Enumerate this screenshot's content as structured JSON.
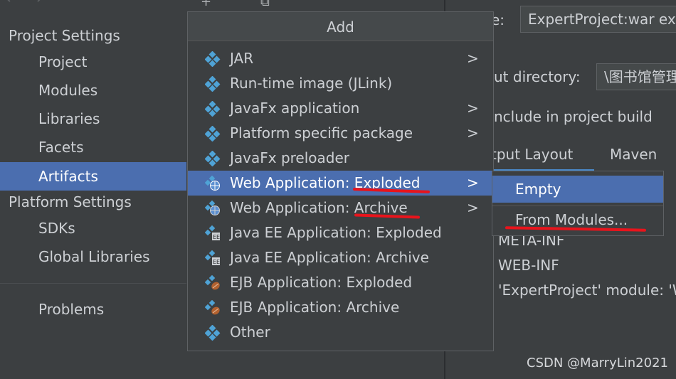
{
  "sidebar": {
    "project_settings_title": "Project Settings",
    "project_items": [
      {
        "label": "Project"
      },
      {
        "label": "Modules"
      },
      {
        "label": "Libraries"
      },
      {
        "label": "Facets"
      },
      {
        "label": "Artifacts"
      }
    ],
    "platform_settings_title": "Platform Settings",
    "platform_items": [
      {
        "label": "SDKs"
      },
      {
        "label": "Global Libraries"
      }
    ],
    "problems_label": "Problems"
  },
  "details": {
    "name_label_partial": "e:",
    "name_value": "ExpertProject:war ex",
    "output_dir_label_partial": "ut directory:",
    "output_dir_value": "\\图书馆管理",
    "include_label_partial": "nclude in project build",
    "tabs": [
      {
        "label": "tput Layout"
      },
      {
        "label": "Maven"
      }
    ],
    "tree": [
      {
        "label": "META-INF"
      },
      {
        "label": "WEB-INF"
      },
      {
        "label": "'ExpertProject' module: 'W"
      }
    ]
  },
  "popup": {
    "title": "Add",
    "items": [
      {
        "label": "JAR",
        "icon": "artifact-icon",
        "submenu": ">"
      },
      {
        "label": "Run-time image (JLink)",
        "icon": "artifact-icon",
        "submenu": ""
      },
      {
        "label": "JavaFx application",
        "icon": "artifact-icon",
        "submenu": ">"
      },
      {
        "label": "Platform specific package",
        "icon": "artifact-icon",
        "submenu": ">"
      },
      {
        "label": "JavaFx preloader",
        "icon": "artifact-icon",
        "submenu": ""
      },
      {
        "label": "Web Application: Exploded",
        "icon": "web-artifact-icon",
        "submenu": ">"
      },
      {
        "label": "Web Application: Archive",
        "icon": "web-artifact-icon",
        "submenu": ">"
      },
      {
        "label": "Java EE Application: Exploded",
        "icon": "javaee-artifact-icon",
        "submenu": ""
      },
      {
        "label": "Java EE Application: Archive",
        "icon": "javaee-artifact-icon",
        "submenu": ""
      },
      {
        "label": "EJB Application: Exploded",
        "icon": "ejb-artifact-icon",
        "submenu": ""
      },
      {
        "label": "EJB Application: Archive",
        "icon": "ejb-artifact-icon",
        "submenu": ""
      },
      {
        "label": "Other",
        "icon": "artifact-icon",
        "submenu": ""
      }
    ]
  },
  "submenu": {
    "items": [
      {
        "label": "Empty"
      },
      {
        "label": "From Modules..."
      }
    ]
  },
  "watermark": "CSDN @MarryLin2021",
  "colors": {
    "selection": "#4b6eaf",
    "background": "#3c3f41",
    "annotation_red": "#e8141c",
    "icon_blue": "#4fa3d6"
  }
}
